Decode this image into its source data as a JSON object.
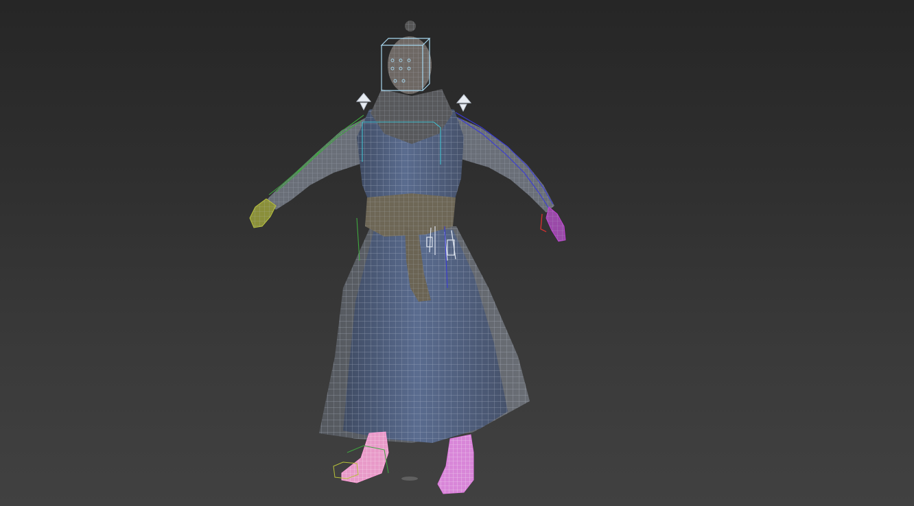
{
  "viewport": {
    "background_top": "#262626",
    "background_bottom": "#414141",
    "shading_mode": "shaded-with-wireframe"
  },
  "model": {
    "pose": "T-pose",
    "robe_color": "#5a6c8f",
    "wire_color": "#b9c4d6",
    "sash_color": "#7a7260",
    "skin_color": "#7d7672"
  },
  "rig": {
    "left_arm_color": "#3fa83f",
    "left_hand_color": "#b8c23a",
    "right_arm_color": "#3a3ad8",
    "right_hand_color": "#c23fd6",
    "right_fingertip_color": "#d03030",
    "head_box_color": "#a8d8f0",
    "spine_color": "#40c0d0",
    "left_foot_color": "#ff9ad8",
    "right_foot_color": "#e07ae0",
    "left_toe_color": "#b8c23a",
    "leg_right_color": "#3a3ad8"
  }
}
